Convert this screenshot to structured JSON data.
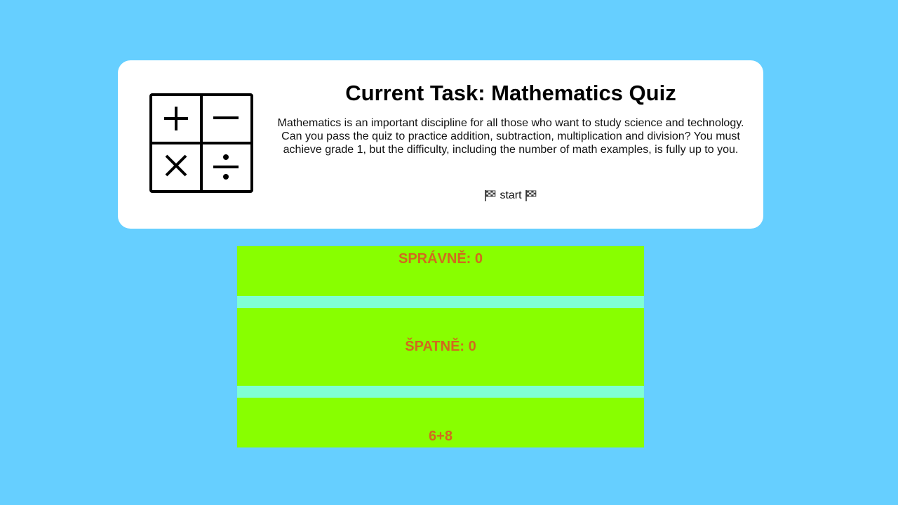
{
  "task_card": {
    "title": "Current Task: Mathematics Quiz",
    "description": "Mathematics is an important discipline for all those who want to study science and technology. Can you pass the quiz to practice addition, subtraction, multiplication and division? You must achieve grade 1, but the difficulty, including the number of math examples, is fully up to you.",
    "start_label": "start",
    "logo_icon": "math-operators-icon",
    "flag_icon": "checkered-flag-icon"
  },
  "quiz": {
    "correct_label": "SPRÁVNĚ: 0",
    "wrong_label": "ŠPATNĚ: 0",
    "problem": "6+8"
  },
  "colors": {
    "background": "#66cfff",
    "panel": "#88ff00",
    "panel_text": "#d2691e",
    "separator": "#7fffd4"
  }
}
